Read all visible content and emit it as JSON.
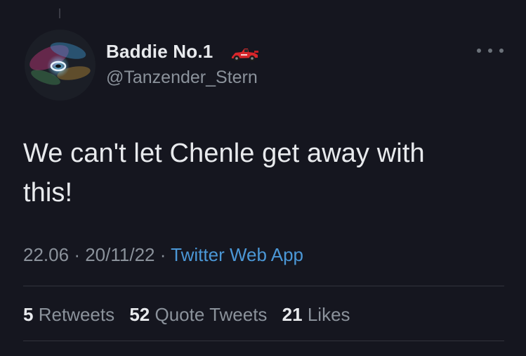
{
  "author": {
    "display_name": "Baddie No.1",
    "handle": "@Tanzender_Stern",
    "name_emoji": "racing-car-emoji"
  },
  "tweet": {
    "text_line1": "We can't let Chenle get away with",
    "text_line2": "this!"
  },
  "meta": {
    "time": "22.06",
    "separator": "·",
    "date": "20/11/22",
    "source": "Twitter Web App"
  },
  "stats": {
    "retweets_count": "5",
    "retweets_label": "Retweets",
    "quotes_count": "52",
    "quotes_label": "Quote Tweets",
    "likes_count": "21",
    "likes_label": "Likes"
  },
  "colors": {
    "background": "#15161f",
    "text_primary": "#e8eaed",
    "text_secondary": "#8b929b",
    "link": "#4b97d6",
    "divider": "#32343d"
  }
}
